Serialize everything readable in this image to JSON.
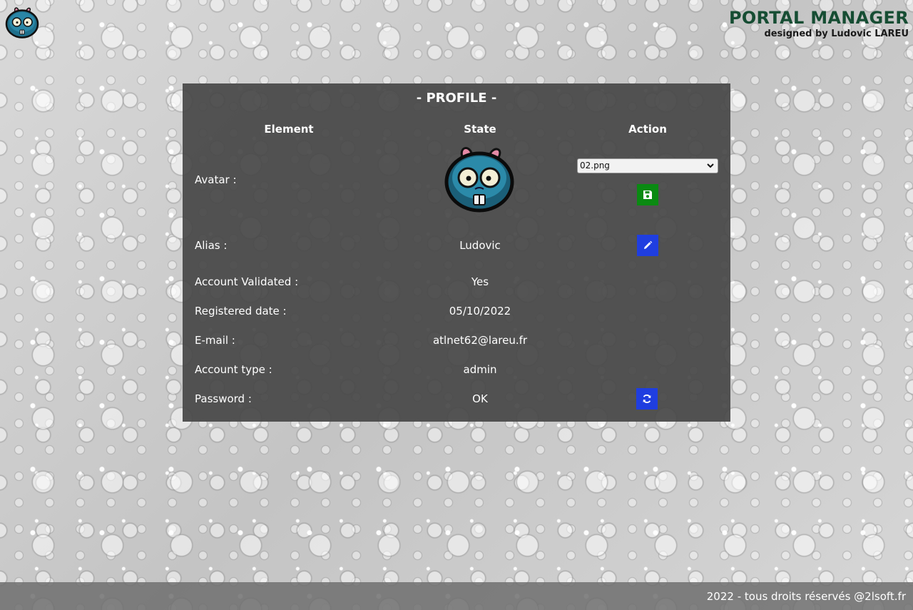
{
  "header": {
    "title": "PORTAL MANAGER",
    "subtitle": "designed by Ludovic LAREU",
    "logo_icon": "zombie-avatar-icon"
  },
  "profile": {
    "title": "- PROFILE -",
    "columns": {
      "element": "Element",
      "state": "State",
      "action": "Action"
    },
    "rows": [
      {
        "label": "Avatar :",
        "value": "",
        "action": "avatar-select-save"
      },
      {
        "label": "Alias :",
        "value": "Ludovic",
        "action": "edit"
      },
      {
        "label": "Account Validated :",
        "value": "Yes",
        "action": ""
      },
      {
        "label": "Registered date :",
        "value": "05/10/2022",
        "action": ""
      },
      {
        "label": "E-mail :",
        "value": "atlnet62@lareu.fr",
        "action": ""
      },
      {
        "label": "Account type :",
        "value": "admin",
        "action": ""
      },
      {
        "label": "Password :",
        "value": "OK",
        "action": "reset"
      }
    ],
    "avatar_select": {
      "selected": "02.png"
    }
  },
  "colors": {
    "brand_green": "#164d33",
    "save_green": "#0a8a12",
    "action_blue": "#1f3ee0",
    "panel_bg": "#464646"
  },
  "icons": {
    "save": "floppy-disk-icon",
    "edit": "pencil-icon",
    "reset": "refresh-icon",
    "dropdown": "chevron-down-icon"
  },
  "footer": {
    "text": "2022 - tous droits réservés @2lsoft.fr"
  }
}
